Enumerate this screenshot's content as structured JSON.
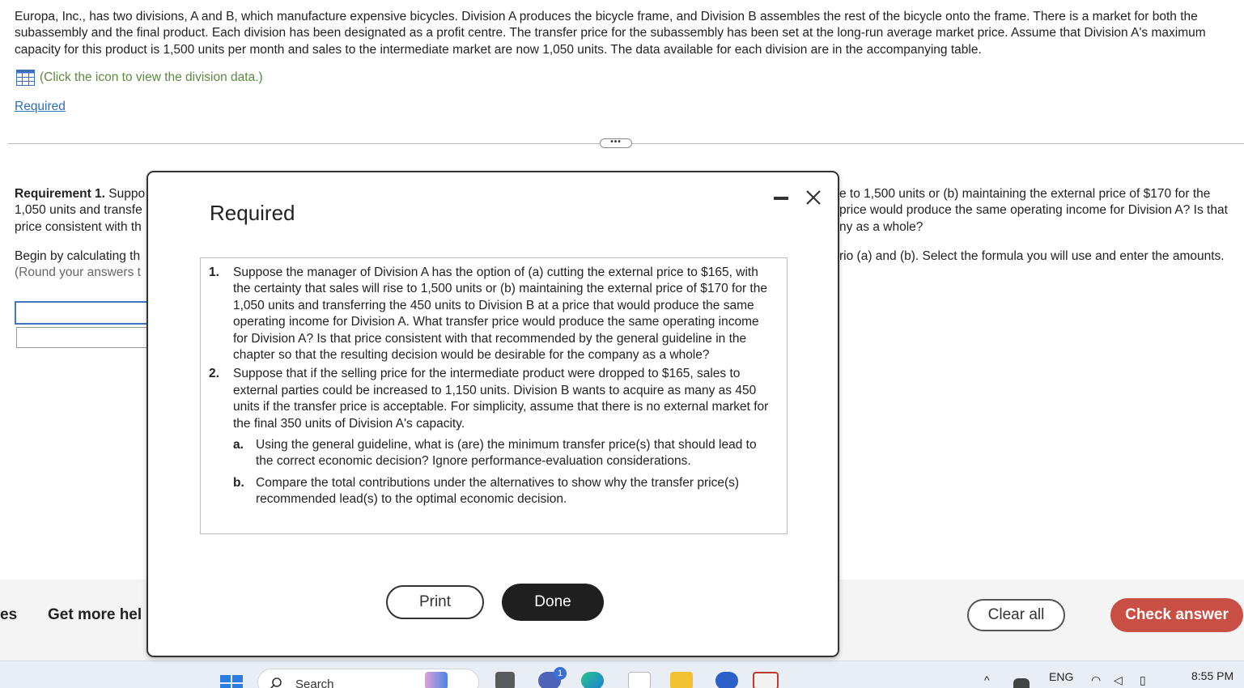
{
  "intro": {
    "text": "Europa, Inc., has two divisions, A and B, which manufacture expensive bicycles. Division A produces the bicycle frame, and Division B assembles the rest of the bicycle onto the frame. There is a market for both the subassembly and the final product. Each division has been designated as a profit centre. The transfer price for the subassembly has been set at the long-run average market price. Assume that Division A's maximum capacity for this product is 1,500 units per month and sales to the intermediate market are now 1,050 units. The data available for each division are in the accompanying table.",
    "data_link": "(Click the icon to view the division data.)",
    "required_link": "Required"
  },
  "background": {
    "req_left_1_bold": "Requirement 1.",
    "req_left_1_rest": " Suppo",
    "req_left_2": "1,050 units and transfe",
    "req_left_3": "price consistent with th",
    "req_right_1": "e to 1,500 units or (b) maintaining the external price of $170 for the",
    "req_right_2": "price would produce the same operating income for Division A? Is that",
    "req_right_3": "ny as a whole?",
    "begin_left": "Begin by calculating th",
    "round_left": "(Round your answers t",
    "begin_right": "rio (a) and (b). Select the formula you will use and enter the amounts."
  },
  "bottom_bar": {
    "left_fragment": "es",
    "help": "Get more hel",
    "clear_all": "Clear all",
    "check_answer": "Check answer"
  },
  "taskbar": {
    "search_placeholder": "Search",
    "language": "ENG",
    "time": "8:55 PM",
    "notification_count": "1"
  },
  "modal": {
    "title": "Required",
    "q1_num": "1.",
    "q1_text": "Suppose the manager of Division A has the option of (a) cutting the external price to $165, with the certainty that sales will rise to 1,500 units or (b) maintaining the external price of $170 for the 1,050 units and transferring the 450 units to Division B at a price that would produce the same operating income for Division A. What transfer price would produce the same operating income for Division A? Is that price consistent with that recommended by the general guideline in the chapter so that the resulting decision would be desirable for the company as a whole?",
    "q2_num": "2.",
    "q2_text": "Suppose that if the selling price for the intermediate product were dropped to $165, sales to external parties could be increased to 1,150 units. Division B wants to acquire as many as 450 units if the transfer price is acceptable. For simplicity, assume that there is no external market for the final 350 units of Division A's capacity.",
    "q2a_num": "a.",
    "q2a_text": "Using the general guideline, what is (are) the minimum transfer price(s) that should lead to the correct economic decision? Ignore performance-evaluation considerations.",
    "q2b_num": "b.",
    "q2b_text": "Compare the total contributions under the alternatives to show why the transfer price(s) recommended lead(s) to the optimal economic decision.",
    "print_label": "Print",
    "done_label": "Done"
  },
  "colors": {
    "check_button": "#c94f45",
    "done_button": "#1f1f1f",
    "link_blue": "#2f6fb0",
    "data_link_green": "#5d8a3f"
  }
}
